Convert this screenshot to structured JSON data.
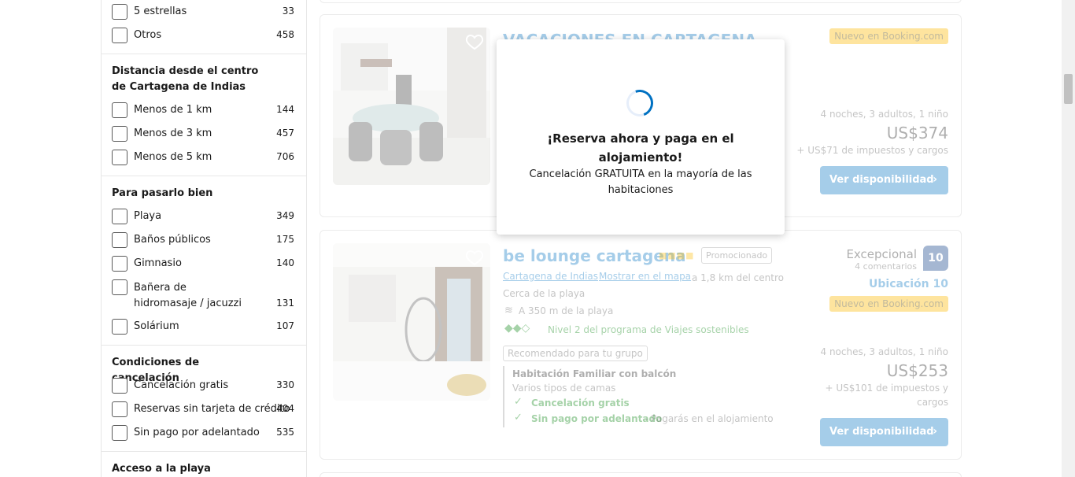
{
  "sidebar": {
    "stars": [
      {
        "label": "5 estrellas",
        "count": "33"
      },
      {
        "label": "Otros",
        "count": "458"
      }
    ],
    "distance": {
      "title": "Distancia desde el centro de Cartagena de Indias",
      "items": [
        {
          "label": "Menos de 1 km",
          "count": "144"
        },
        {
          "label": "Menos de 3 km",
          "count": "457"
        },
        {
          "label": "Menos de 5 km",
          "count": "706"
        }
      ]
    },
    "fun": {
      "title": "Para pasarlo bien",
      "items": [
        {
          "label": "Playa",
          "count": "349"
        },
        {
          "label": "Baños públicos",
          "count": "175"
        },
        {
          "label": "Gimnasio",
          "count": "140"
        },
        {
          "label": "Bañera de hidromasaje / jacuzzi",
          "count": "131"
        },
        {
          "label": "Solárium",
          "count": "107"
        }
      ]
    },
    "cancel": {
      "title": "Condiciones de cancelación",
      "items": [
        {
          "label": "Cancelación gratis",
          "count": "330"
        },
        {
          "label": "Reservas sin tarjeta de crédito",
          "count": "404"
        },
        {
          "label": "Sin pago por adelantado",
          "count": "535"
        }
      ]
    },
    "beach": {
      "title": "Acceso a la playa"
    }
  },
  "listings": [
    {
      "title": "VACACIONES EN CARTAGENA",
      "badge": "Nuevo en Booking.com",
      "stay": "4 noches, 3 adultos, 1 niño",
      "price": "US$374",
      "taxes": "+ US$71 de impuestos y cargos",
      "cta": "Ver disponibilidad"
    },
    {
      "title": "be lounge cartagena",
      "promo": "Promocionado",
      "city_link": "Cartagena de Indias",
      "map_link": "Mostrar en el mapa",
      "distance": "a 1,8 km del centro",
      "near": "Cerca de la playa",
      "beach_distance": "A 350 m de la playa",
      "sustain": "Nivel 2 del programa de Viajes sostenibles",
      "group_tag": "Recomendado para tu grupo",
      "room": "Habitación Familiar con balcón",
      "beds": "Varios tipos de camas",
      "free_cancel": "Cancelación gratis",
      "no_prepay": "Sin pago por adelantado",
      "pay_at": "- Pagarás en el alojamiento",
      "rating_word": "Excepcional",
      "reviews": "4 comentarios",
      "score": "10",
      "location_score": "Ubicación 10",
      "badge": "Nuevo en Booking.com",
      "stay": "4 noches, 3 adultos, 1 niño",
      "price": "US$253",
      "taxes_l1": "+ US$101 de impuestos y",
      "taxes_l2": "cargos",
      "cta": "Ver disponibilidad"
    }
  ],
  "modal": {
    "title": "¡Reserva ahora y paga en el alojamiento!",
    "subtitle": "Cancelación GRATUITA en la mayoría de las habitaciones"
  }
}
